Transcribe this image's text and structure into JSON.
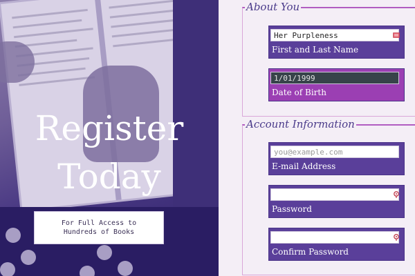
{
  "hero": {
    "title_line1": "Register",
    "title_line2": "Today",
    "subtitle": "For Full Access to Hundreds of Books"
  },
  "about": {
    "legend": "About You",
    "name_value": "Her Purpleness",
    "name_label": "First and Last Name",
    "dob_value": "1/01/1999",
    "dob_label": "Date of Birth"
  },
  "account": {
    "legend": "Account Information",
    "email_placeholder": "you@example.com",
    "email_label": "E-mail Address",
    "password_value": "",
    "password_label": "Password",
    "confirm_value": "",
    "confirm_label": "Confirm Password"
  },
  "icons": {
    "name_field_icon": "contact-card-icon",
    "password_field_icon": "key-icon",
    "confirm_field_icon": "key-icon"
  },
  "colors": {
    "field_bg": "#5a3f9a",
    "field_active_bg": "#9b3fb3",
    "legend_color": "#4a3a8a",
    "border_accent": "#b15cc1"
  }
}
